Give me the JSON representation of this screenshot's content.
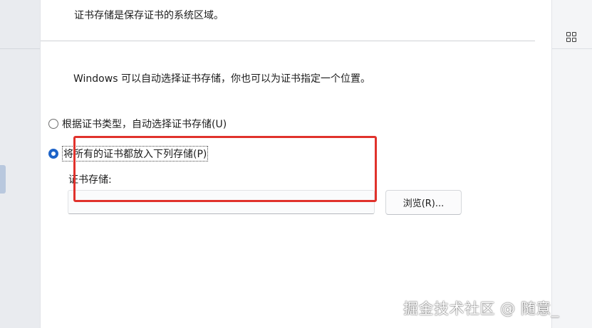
{
  "dialog": {
    "header_description": "证书存储是保存证书的系统区域。",
    "intro_text": "Windows 可以自动选择证书存储，你也可以为证书指定一个位置。",
    "options": [
      {
        "label": "根据证书类型，自动选择证书存储(U)",
        "checked": false
      },
      {
        "label": "将所有的证书都放入下列存储(P)",
        "checked": true
      }
    ],
    "store_label": "证书存储:",
    "store_value": "",
    "browse_label": "浏览(R)..."
  },
  "background": {
    "grid_icon": "grid-icon"
  },
  "annotation": {
    "highlight_color": "#e0322c"
  },
  "watermark": {
    "text": "掘金技术社区 @ 随意_"
  }
}
